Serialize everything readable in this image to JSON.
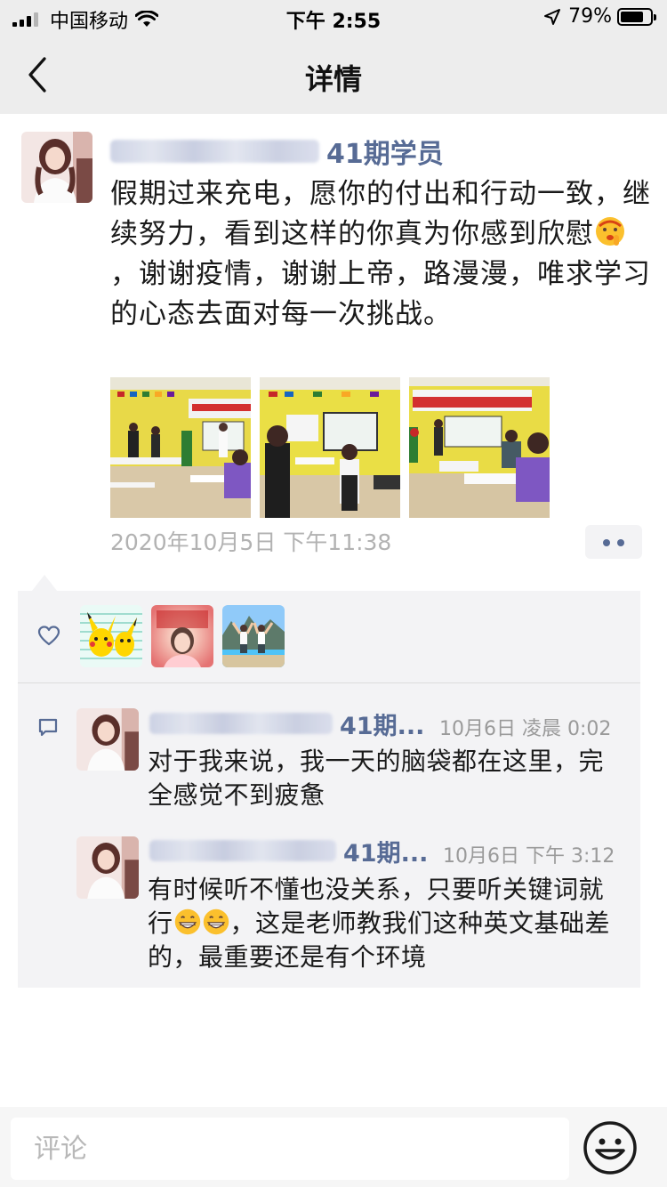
{
  "status_bar": {
    "carrier": "中国移动",
    "time": "下午 2:55",
    "battery": "79%",
    "battery_level": 0.79
  },
  "nav": {
    "title": "详情"
  },
  "post": {
    "author_suffix": "41期学员",
    "text": "假期过来充电，愿你的付出和行动一致，继续努力，看到这样的你真为你感到欣慰",
    "text_after_emoji": "，谢谢疫情，谢谢上帝，路漫漫，唯求学习的心态去面对每一次挑战。",
    "photos": [
      "classroom-photo-1",
      "classroom-photo-2",
      "classroom-photo-3"
    ],
    "banner_text_1": "第41期特级国际双语师资培训",
    "banner_text_2": "第41期特级国际双语师资培训",
    "time": "2020年10月5日 下午11:38"
  },
  "comments": [
    {
      "author": "41期...",
      "time": "10月6日 凌晨 0:02",
      "text": "对于我来说，我一天的脑袋都在这里，完全感觉不到疲惫"
    },
    {
      "author": "41期...",
      "time": "10月6日 下午 3:12",
      "text_before_emoji": "有时候听不懂也没关系，只要听关键词就行",
      "text_after_emoji": "，这是老师教我们这种英文基础差的，最重要还是有个环境"
    }
  ],
  "input": {
    "placeholder": "评论"
  },
  "colors": {
    "link": "#576b95",
    "panel": "#f3f3f5",
    "bar": "#ededed"
  }
}
